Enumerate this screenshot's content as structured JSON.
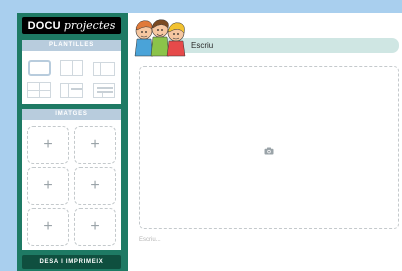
{
  "app": {
    "logo_bold": "DOCU",
    "logo_script": "projectes"
  },
  "sidebar": {
    "templates_header": "PLANTILLES",
    "images_header": "IMATGES",
    "add_symbol": "+",
    "save_button": "DESA I IMPRIMEIX"
  },
  "document": {
    "title": "Escriu",
    "caption_placeholder": "Escriu..."
  },
  "colors": {
    "background": "#a9cfee",
    "sidebar": "#1e7a64",
    "header_strip": "#b8ccdd",
    "title_bar": "#cfe6e3",
    "save_button": "#0f4f3f"
  },
  "icons": [
    "kids-illustration",
    "camera-icon",
    "plus-icon"
  ]
}
